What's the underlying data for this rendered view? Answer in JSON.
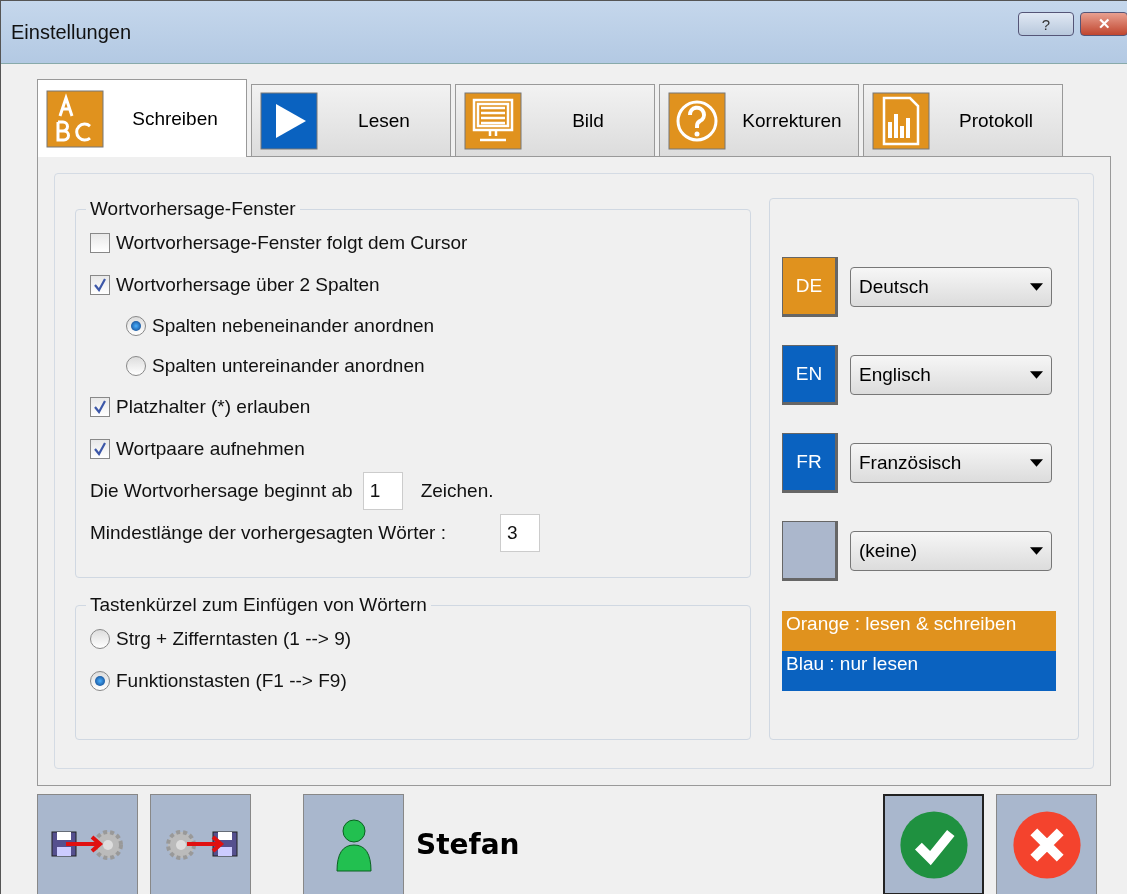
{
  "window": {
    "title": "Einstellungen",
    "help_button": "?",
    "close_button": "✕"
  },
  "tabs": [
    {
      "label": "Schreiben",
      "kind": "abc",
      "color": "#e0921e",
      "selected": true
    },
    {
      "label": "Lesen",
      "kind": "play",
      "color": "#0a62c0",
      "selected": false
    },
    {
      "label": "Bild",
      "kind": "monitor",
      "color": "#e0921e",
      "selected": false
    },
    {
      "label": "Korrekturen",
      "kind": "question",
      "color": "#e0921e",
      "selected": false
    },
    {
      "label": "Protokoll",
      "kind": "report",
      "color": "#e0921e",
      "selected": false
    }
  ],
  "prediction_group": {
    "title": "Wortvorhersage-Fenster",
    "options": [
      {
        "kind": "checkbox",
        "label": "Wortvorhersage-Fenster folgt dem Cursor",
        "checked": false
      },
      {
        "kind": "checkbox",
        "label": "Wortvorhersage über 2 Spalten",
        "checked": true
      },
      {
        "kind": "radio",
        "label": "Spalten nebeneinander anordnen",
        "checked": true
      },
      {
        "kind": "radio",
        "label": "Spalten untereinander anordnen",
        "checked": false
      },
      {
        "kind": "checkbox",
        "label": "Platzhalter (*) erlauben",
        "checked": true
      },
      {
        "kind": "checkbox",
        "label": "Wortpaare aufnehmen",
        "checked": true
      }
    ],
    "start_label": "Die Wortvorhersage beginnt ab",
    "start_value": "1",
    "start_unit": "Zeichen.",
    "min_label": "Mindestlänge der vorhergesagten Wörter :",
    "min_value": "3"
  },
  "shortcut_group": {
    "title": "Tastenkürzel zum Einfügen von Wörtern",
    "options": [
      {
        "label": "Strg + Zifferntasten (1 --> 9)",
        "selected": false
      },
      {
        "label": "Funktionstasten (F1 --> F9)",
        "selected": true
      }
    ]
  },
  "languages": [
    {
      "code": "DE",
      "color": "#e0921e",
      "value": "Deutsch"
    },
    {
      "code": "EN",
      "color": "#0a62c0",
      "value": "Englisch"
    },
    {
      "code": "FR",
      "color": "#0a62c0",
      "value": "Französisch"
    },
    {
      "color": "#abb7cc",
      "value": "(keine)"
    }
  ],
  "legend": [
    {
      "text": "Orange : lesen & schreiben",
      "color": "#e0921e"
    },
    {
      "text": "Blau : nur lesen",
      "color": "#0a62c0"
    }
  ],
  "footer": {
    "user": "Stefan"
  }
}
